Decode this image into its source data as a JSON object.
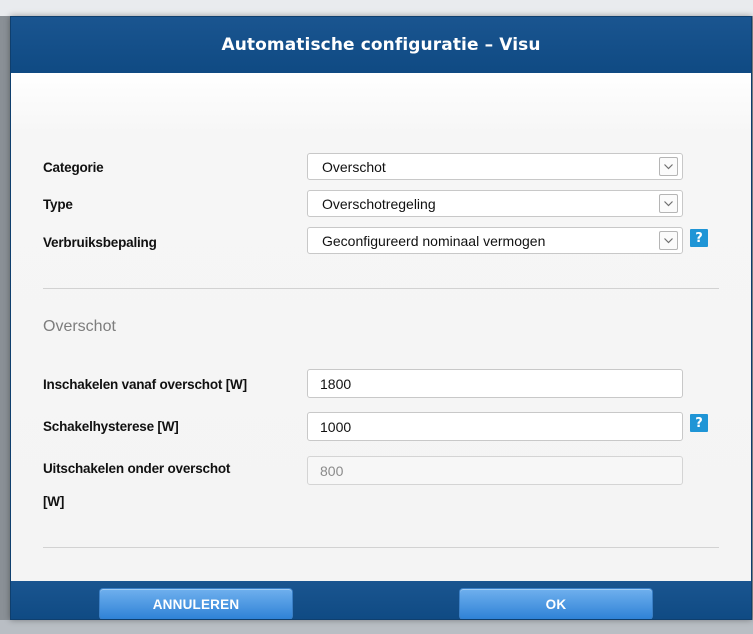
{
  "dialog": {
    "title": "Automatische configuratie – Visu"
  },
  "fields": {
    "categorie": {
      "label": "Categorie",
      "value": "Overschot"
    },
    "type": {
      "label": "Type",
      "value": "Overschotregeling"
    },
    "verbruiksbepaling": {
      "label": "Verbruiksbepaling",
      "value": "Geconfigureerd nominaal vermogen"
    }
  },
  "section": {
    "title": "Overschot",
    "inschakelen": {
      "label": "Inschakelen vanaf overschot [W]",
      "value": "1800"
    },
    "hysterese": {
      "label": "Schakelhysterese [W]",
      "value": "1000"
    },
    "uitschakelen": {
      "label_line1": "Uitschakelen onder overschot",
      "label_line2": "[W]",
      "value": "800"
    }
  },
  "help_icon": "?",
  "buttons": {
    "cancel_label": "ANNULEREN",
    "ok_label": "OK"
  },
  "colors": {
    "header": "#0f4a83",
    "button": "#2f82d6",
    "help": "#1f95d6"
  }
}
